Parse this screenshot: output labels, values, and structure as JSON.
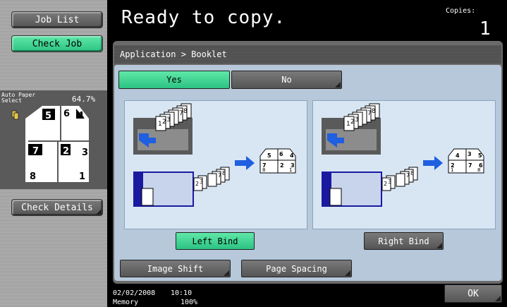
{
  "left_panel": {
    "job_list_label": "Job List",
    "check_job_label": "Check Job",
    "paper_select_label": "Auto Paper Select",
    "zoom_label": "64.7%",
    "preview_page_numbers": [
      "5",
      "6",
      "4",
      "7",
      "2",
      "3",
      "8",
      "1"
    ],
    "check_details_label": "Check Details"
  },
  "header": {
    "status_message": "Ready to copy.",
    "copies_label": "Copies:",
    "copies_value": "1"
  },
  "breadcrumb": "Application > Booklet",
  "booklet": {
    "yes_label": "Yes",
    "no_label": "No",
    "selected": "Yes",
    "left_bind": {
      "label": "Left Bind",
      "selected": true,
      "stack_numbers": [
        "1",
        "2",
        "3",
        "7",
        "8"
      ],
      "result_numbers": [
        "5",
        "6",
        "4",
        "7",
        "2",
        "3",
        "8",
        "1"
      ]
    },
    "right_bind": {
      "label": "Right Bind",
      "selected": false,
      "stack_numbers": [
        "1",
        "2",
        "3",
        "7",
        "8"
      ],
      "result_numbers": [
        "4",
        "3",
        "5",
        "2",
        "7",
        "6",
        "1",
        "8"
      ]
    }
  },
  "bottom_buttons": {
    "image_shift_label": "Image Shift",
    "page_spacing_label": "Page Spacing",
    "ok_label": "OK"
  },
  "status_bar": {
    "date": "02/02/2008",
    "time": "10:10",
    "memory_label": "Memory",
    "memory_value": "100%"
  },
  "colors": {
    "selected_green": "#2cc383",
    "content_blue": "#b6c8da",
    "arrow_blue": "#1f5fe0"
  }
}
